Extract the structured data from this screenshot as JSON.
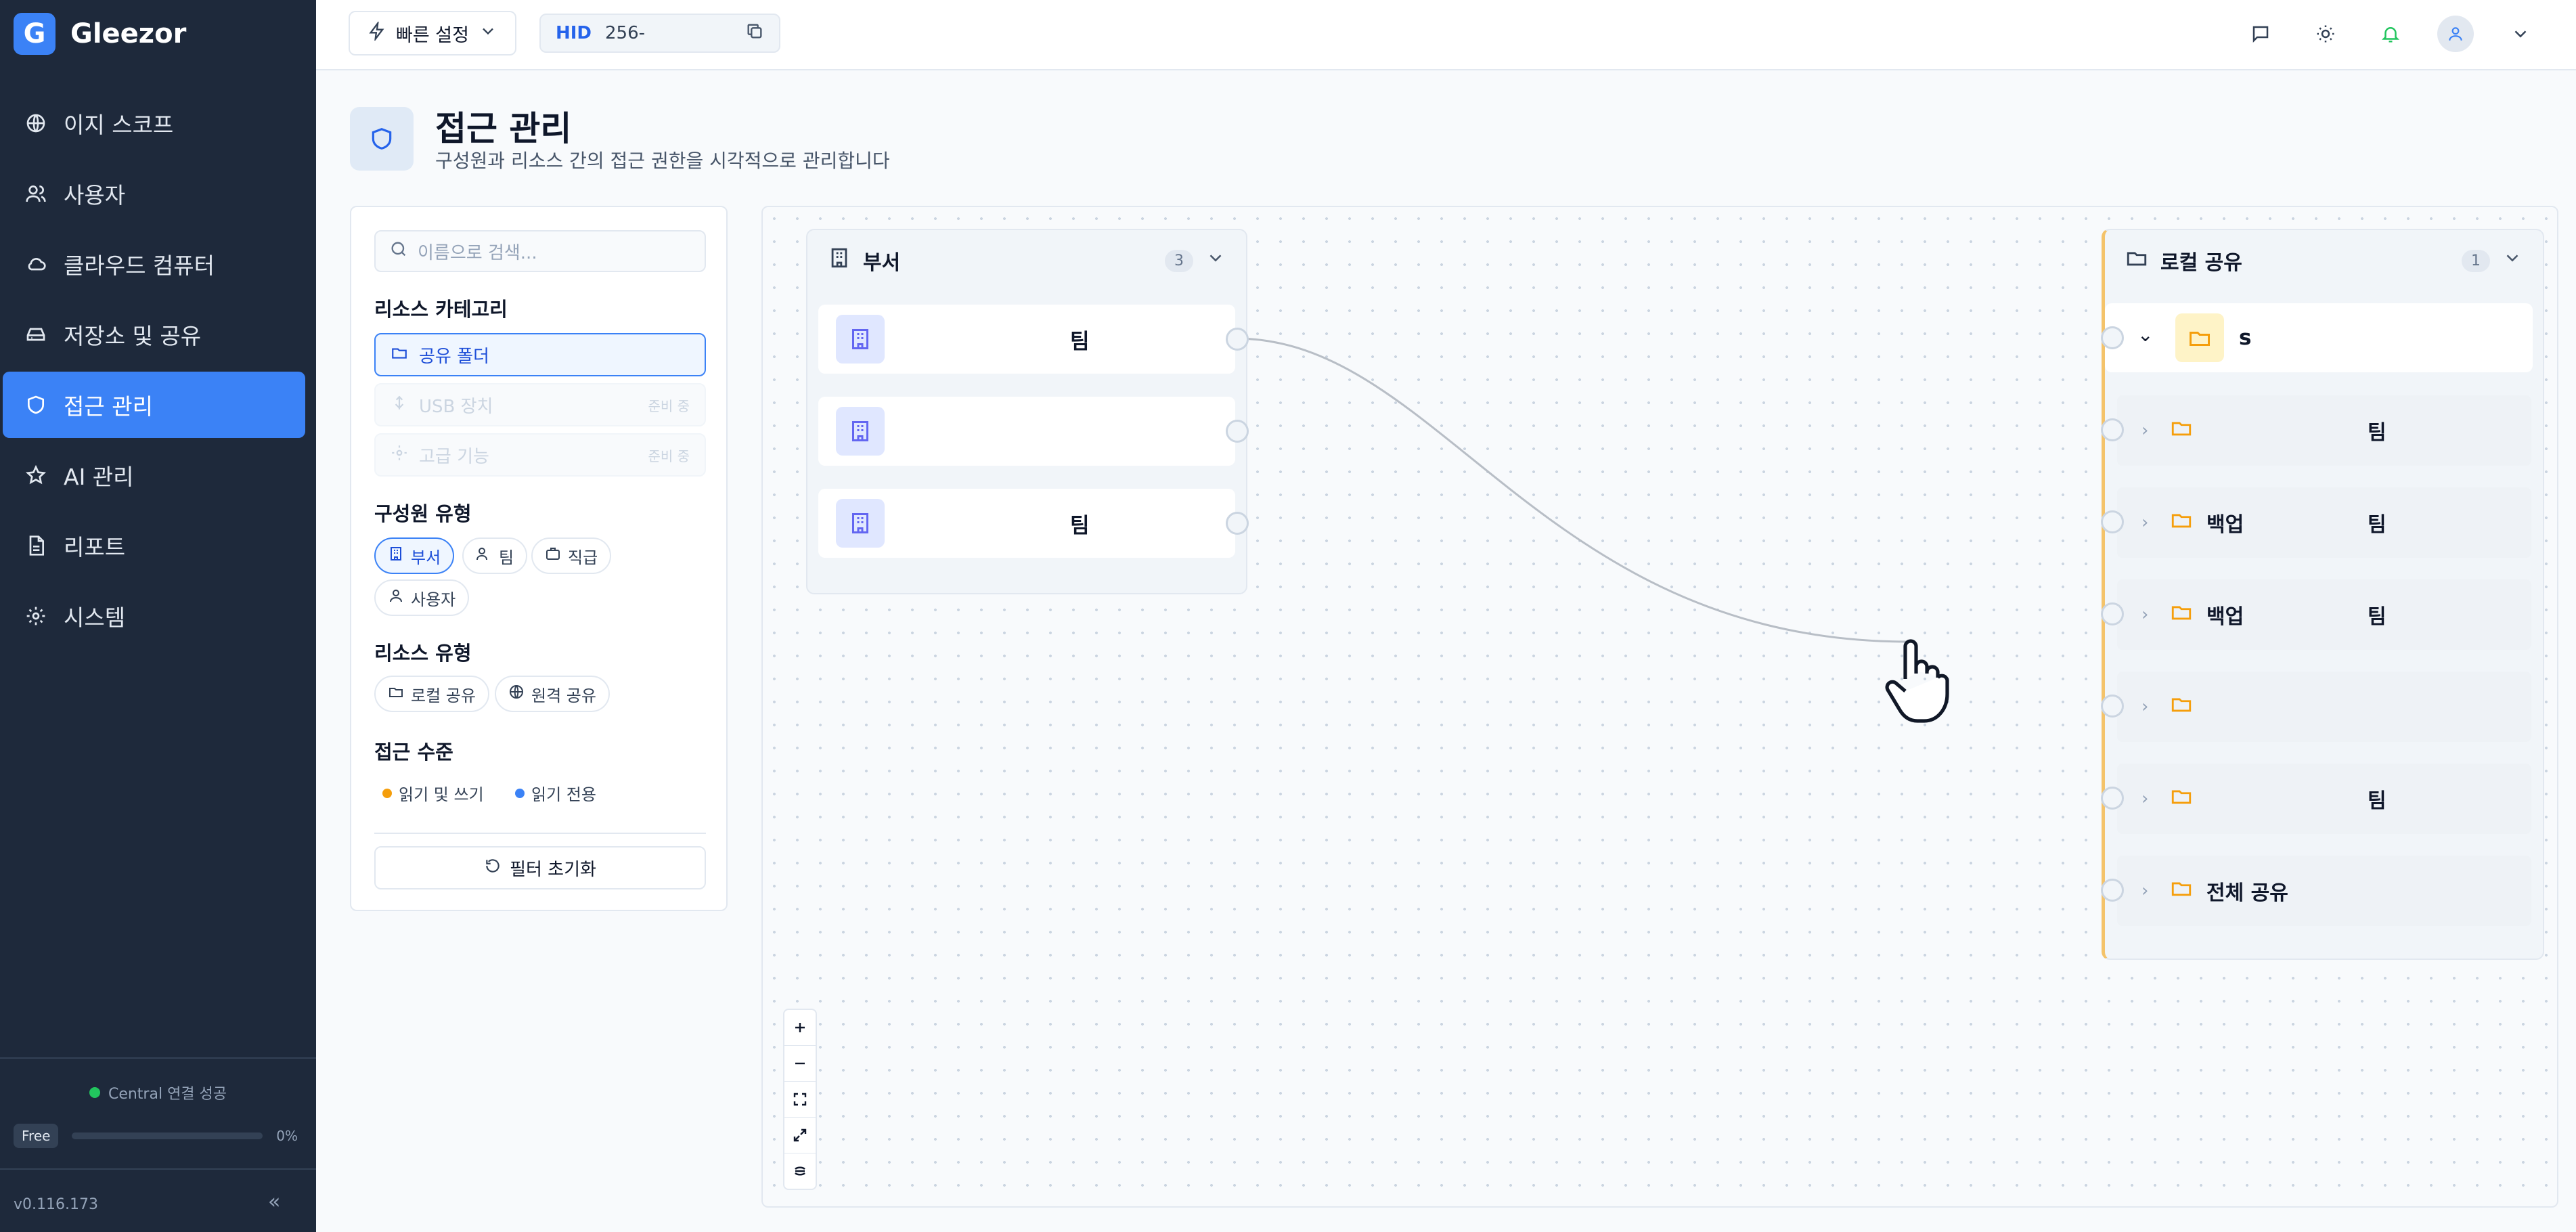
{
  "brand": {
    "logo_letter": "G",
    "name": "Gleezor",
    "accent": "#3b82f6"
  },
  "sidebar": {
    "items": [
      {
        "label": "이지 스코프",
        "icon": "globe-icon"
      },
      {
        "label": "사용자",
        "icon": "users-icon"
      },
      {
        "label": "클라우드 컴퓨터",
        "icon": "cloud-icon"
      },
      {
        "label": "저장소 및 공유",
        "icon": "storage-icon"
      },
      {
        "label": "접근 관리",
        "icon": "shield-icon",
        "active": true
      },
      {
        "label": "AI 관리",
        "icon": "star-icon"
      },
      {
        "label": "리포트",
        "icon": "report-icon"
      },
      {
        "label": "시스템",
        "icon": "gear-icon"
      }
    ],
    "connection_status": "Central 연결 성공",
    "plan": {
      "badge": "Free",
      "usage_percent_label": "0%",
      "usage_fraction": 0
    },
    "version": "v0.116.173",
    "collapse_label": "«"
  },
  "topbar": {
    "quick_settings_label": "빠른 설정",
    "hid_label": "HID",
    "hid_value": "256-",
    "icons": [
      "chat-icon",
      "sun-icon",
      "bell-icon",
      "user-icon",
      "chevron-down-icon"
    ]
  },
  "page": {
    "title": "접근 관리",
    "subtitle": "구성원과 리소스 간의 접근 권한을 시각적으로 관리합니다"
  },
  "filters": {
    "search_placeholder": "이름으로 검색...",
    "resource_category_title": "리소스 카테고리",
    "categories": [
      {
        "label": "공유 폴더",
        "state": "active"
      },
      {
        "label": "USB 장치",
        "badge": "준비 중",
        "state": "disabled"
      },
      {
        "label": "고급 기능",
        "badge": "준비 중",
        "state": "disabled"
      }
    ],
    "member_type_title": "구성원 유형",
    "member_types": [
      {
        "label": "부서",
        "active": true
      },
      {
        "label": "팀"
      },
      {
        "label": "직급"
      },
      {
        "label": "사용자"
      }
    ],
    "resource_type_title": "리소스 유형",
    "resource_types": [
      {
        "label": "로컬 공유"
      },
      {
        "label": "원격 공유"
      }
    ],
    "access_level_title": "접근 수준",
    "access_levels": [
      {
        "label": "읽기 및 쓰기",
        "color": "#f59e0b"
      },
      {
        "label": "읽기 전용",
        "color": "#3b82f6"
      }
    ],
    "reset_label": "필터 초기화"
  },
  "canvas": {
    "department_node": {
      "title": "부서",
      "count": "3",
      "rows": [
        {
          "label": "팀"
        },
        {
          "label": ""
        },
        {
          "label": "팀"
        }
      ]
    },
    "share_node": {
      "title": "로컬 공유",
      "count": "1",
      "root_label": "s",
      "accent": "#f59e0b",
      "rows": [
        {
          "name": "",
          "tag": "팀"
        },
        {
          "name": "백업",
          "tag": "팀"
        },
        {
          "name": "백업",
          "tag": "팀"
        },
        {
          "name": "",
          "tag": ""
        },
        {
          "name": "",
          "tag": "팀"
        },
        {
          "name": "전체 공유",
          "tag": ""
        }
      ]
    },
    "zoom_controls": [
      "zoom-in",
      "zoom-out",
      "fit-view",
      "fullscreen",
      "toggle-lock"
    ]
  }
}
